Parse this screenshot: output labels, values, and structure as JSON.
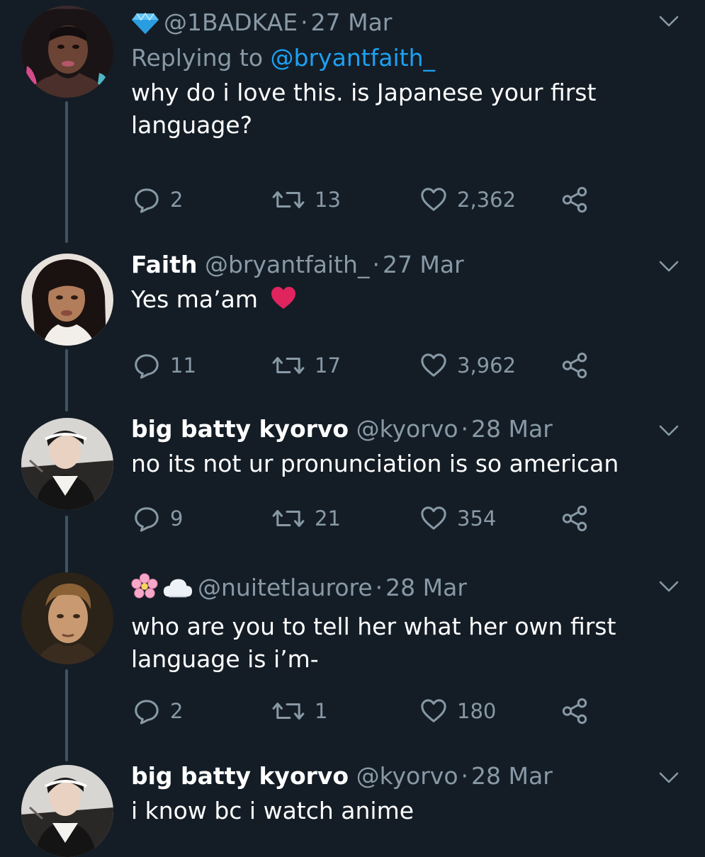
{
  "colors": {
    "background": "#141d26",
    "text_primary": "#ffffff",
    "text_secondary": "#8899a6",
    "mention": "#1da1f2",
    "thread_line": "#3d5466"
  },
  "tweets": [
    {
      "display_name": "",
      "name_emoji": "gem-icon",
      "handle": "@1BADKAE",
      "date": "27 Mar",
      "replying_prefix": "Replying to ",
      "replying_to": "@bryantfaith_",
      "text_lines": [
        "why do i love this. is Japanese your first",
        "language?"
      ],
      "replies": "2",
      "retweets": "13",
      "likes": "2,362"
    },
    {
      "display_name": "Faith",
      "handle": "@bryantfaith_",
      "date": "27 Mar",
      "text": "Yes ma’am",
      "text_emoji": "red-heart-emoji",
      "replies": "11",
      "retweets": "17",
      "likes": "3,962"
    },
    {
      "display_name": "big batty kyorvo",
      "handle": "@kyorvo",
      "date": "28 Mar",
      "text": "no its not ur pronunciation is so american",
      "replies": "9",
      "retweets": "21",
      "likes": "354"
    },
    {
      "display_name": "",
      "name_emoji": [
        "cherry-blossom-icon",
        "cloud-icon"
      ],
      "handle": "@nuitetlaurore",
      "date": "28 Mar",
      "text_lines": [
        "who are you to tell her what her own first",
        "language is i’m-"
      ],
      "replies": "2",
      "retweets": "1",
      "likes": "180"
    },
    {
      "display_name": "big batty kyorvo",
      "handle": "@kyorvo",
      "date": "28 Mar",
      "text": "i know bc i watch anime"
    }
  ],
  "separator": "·"
}
